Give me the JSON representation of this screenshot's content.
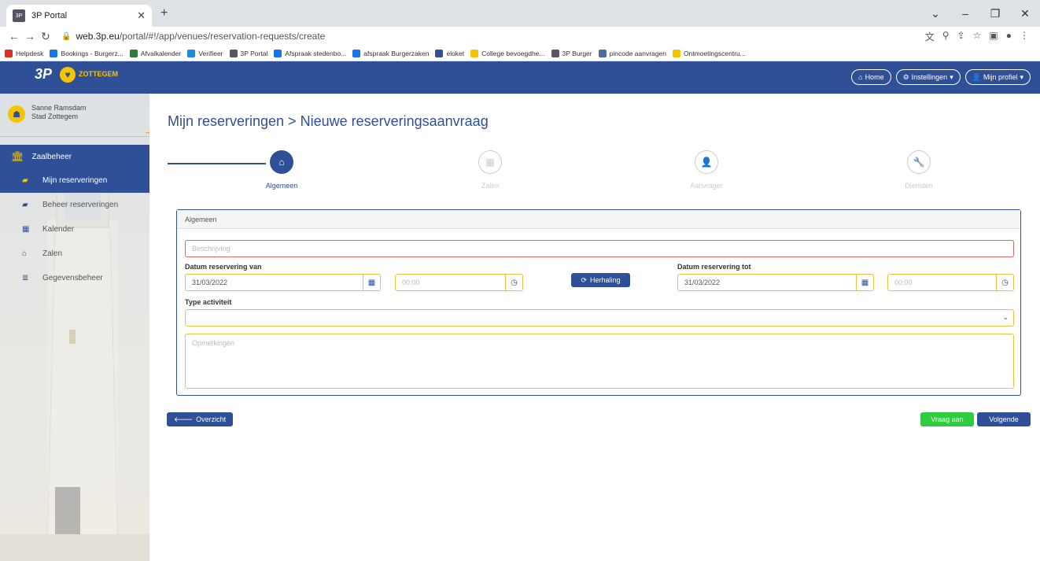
{
  "browser": {
    "tab_title": "3P Portal",
    "tab_favicon": "3P",
    "url_domain": "web.3p.eu",
    "url_path": "/portal/#!/app/venues/reservation-requests/create",
    "bookmarks": [
      {
        "label": "Helpdesk",
        "color": "#d93025"
      },
      {
        "label": "Bookings - Burgerz...",
        "color": "#1a73e8"
      },
      {
        "label": "Afvalkalender",
        "color": "#2e7d32"
      },
      {
        "label": "Verifieer",
        "color": "#1e88e5"
      },
      {
        "label": "3P Portal",
        "color": "#555566"
      },
      {
        "label": "Afspraak stedenbo...",
        "color": "#1a73e8"
      },
      {
        "label": "afspraak Burgerzaken",
        "color": "#1a73e8"
      },
      {
        "label": "eloket",
        "color": "#2f4f97"
      },
      {
        "label": "College bevoegdhe...",
        "color": "#f5c400"
      },
      {
        "label": "3P Burger",
        "color": "#555566"
      },
      {
        "label": "pincode aanvragen",
        "color": "#4a6fa5"
      },
      {
        "label": "Ontmoetingscentru...",
        "color": "#f5c400"
      }
    ]
  },
  "app": {
    "logo": "3P",
    "town": "ZOTTEGEM",
    "nav": {
      "home": "Home",
      "settings": "Instellingen",
      "profile": "Mijn profiel"
    }
  },
  "user": {
    "name": "Sanne Ramsdam",
    "org": "Stad Zottegem"
  },
  "sidebar": {
    "section": "Zaalbeheer",
    "items": [
      {
        "label": "Mijn reserveringen",
        "icon": "book-icon",
        "active": true
      },
      {
        "label": "Beheer reserveringen",
        "icon": "book-icon",
        "active": false
      },
      {
        "label": "Kalender",
        "icon": "calendar-icon",
        "active": false
      },
      {
        "label": "Zalen",
        "icon": "home-icon",
        "active": false
      },
      {
        "label": "Gegevensbeheer",
        "icon": "database-icon",
        "active": false
      }
    ]
  },
  "page": {
    "title": "Mijn reserveringen > Nieuwe reserveringsaanvraag"
  },
  "wizard": {
    "steps": [
      {
        "label": "Algemeen",
        "icon": "home-icon",
        "active": true
      },
      {
        "label": "Zalen",
        "icon": "calendar-icon",
        "active": false
      },
      {
        "label": "Aanvrager",
        "icon": "user-icon",
        "active": false
      },
      {
        "label": "Diensten",
        "icon": "wrench-icon",
        "active": false
      }
    ]
  },
  "form": {
    "panel_title": "Algemeen",
    "description_placeholder": "Beschrijving",
    "from_label": "Datum reservering van",
    "from_date": "31/03/2022",
    "from_time_placeholder": "00:00",
    "repeat_button": "Herhaling",
    "to_label": "Datum reservering tot",
    "to_date": "31/03/2022",
    "to_time_placeholder": "00:00",
    "activity_label": "Type activiteit",
    "activity_value": "",
    "remarks_placeholder": "Opmerkingen"
  },
  "buttons": {
    "overview": "Overzicht",
    "request": "Vraag aan",
    "next": "Volgende"
  },
  "colors": {
    "brand": "#2f4f97",
    "accent": "#f5c400",
    "success": "#2ecc40",
    "error": "#e06666"
  }
}
